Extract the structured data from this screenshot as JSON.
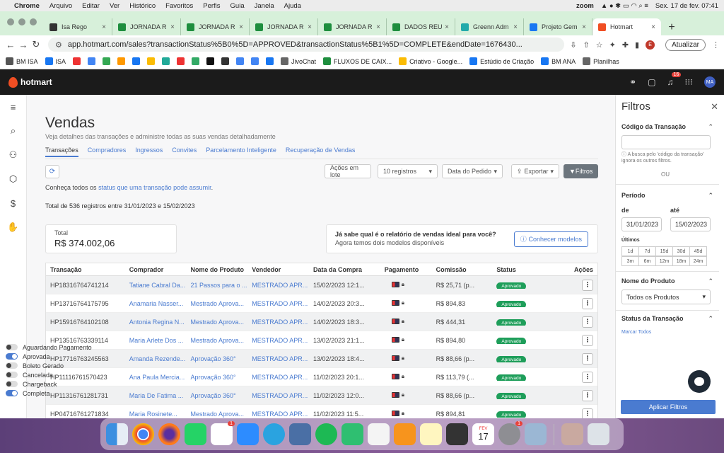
{
  "menubar": {
    "app": "Chrome",
    "items": [
      "Arquivo",
      "Editar",
      "Ver",
      "Histórico",
      "Favoritos",
      "Perfis",
      "Guia",
      "Janela",
      "Ajuda"
    ],
    "zoom": "zoom",
    "datetime": "Sex. 17 de fev.  07:41"
  },
  "browser": {
    "tabs": [
      {
        "label": "Isa Rego",
        "color": "#333"
      },
      {
        "label": "JORNADA R",
        "color": "#1e8e3e"
      },
      {
        "label": "JORNADA R",
        "color": "#1e8e3e"
      },
      {
        "label": "JORNADA R",
        "color": "#1e8e3e"
      },
      {
        "label": "JORNADA R",
        "color": "#1e8e3e"
      },
      {
        "label": "DADOS REU",
        "color": "#1e8e3e"
      },
      {
        "label": "Greenn Adm",
        "color": "#2aa"
      },
      {
        "label": "Projeto Gem",
        "color": "#1877f2"
      },
      {
        "label": "Hotmart",
        "color": "#f04e23"
      }
    ],
    "url": "app.hotmart.com/sales?transactionStatus%5B0%5D=APPROVED&transactionStatus%5B1%5D=COMPLETE&endDate=1676430...",
    "update_label": "Atualizar",
    "bookmarks": [
      {
        "label": "BM ISA",
        "color": "#555"
      },
      {
        "label": "ISA",
        "color": "#1877f2"
      },
      {
        "label": "",
        "color": "#e33"
      },
      {
        "label": "",
        "color": "#4285f4"
      },
      {
        "label": "",
        "color": "#34a853"
      },
      {
        "label": "",
        "color": "#f90"
      },
      {
        "label": "",
        "color": "#1877f2"
      },
      {
        "label": "",
        "color": "#fbbc04"
      },
      {
        "label": "",
        "color": "#2a9"
      },
      {
        "label": "",
        "color": "#e33"
      },
      {
        "label": "",
        "color": "#3a6"
      },
      {
        "label": "",
        "color": "#111"
      },
      {
        "label": "",
        "color": "#333"
      },
      {
        "label": "",
        "color": "#4285f4"
      },
      {
        "label": "",
        "color": "#4285f4"
      },
      {
        "label": "",
        "color": "#1877f2"
      },
      {
        "label": "JivoChat",
        "color": "#666"
      },
      {
        "label": "FLUXOS DE CAIX...",
        "color": "#1e8e3e"
      },
      {
        "label": "Criativo - Google...",
        "color": "#fbbc04"
      },
      {
        "label": "Estúdio de Criação",
        "color": "#1877f2"
      },
      {
        "label": "BM ANA",
        "color": "#1877f2"
      },
      {
        "label": "Planilhas",
        "color": "#666"
      }
    ]
  },
  "header": {
    "brand": "hotmart",
    "notifications": "16",
    "avatar": "MA"
  },
  "page": {
    "title": "Vendas",
    "subtitle": "Veja detalhes das transações e administre todas as suas vendas detalhadamente",
    "tabs": [
      "Transações",
      "Compradores",
      "Ingressos",
      "Convites",
      "Parcelamento Inteligente",
      "Recuperação de Vendas"
    ],
    "bulk_label": "Ações em lote",
    "per_page": "10 registros",
    "sort": "Data do Pedido",
    "export": "Exportar",
    "filters": "Filtros",
    "info_prefix": "Conheça todos os ",
    "info_link": "status que uma transação pode assumir",
    "info_suffix": ".",
    "total_text": "Total de 536 registros entre 31/01/2023 e 15/02/2023",
    "total_label": "Total",
    "total_value": "R$ 374.002,06",
    "promo_bold": "Já sabe qual é o relatório de vendas ideal para você?",
    "promo_rest": " Agora temos dois modelos disponíveis",
    "promo_button": "Conhecer modelos"
  },
  "table": {
    "headers": [
      "Transação",
      "Comprador",
      "Nome do Produto",
      "Vendedor",
      "Data da Compra",
      "Pagamento",
      "Comissão",
      "Status",
      "Ações"
    ],
    "rows": [
      {
        "id": "HP18316764741214",
        "buyer": "Tatiane Cabral Da...",
        "product": "21 Passos para o ...",
        "seller": "MESTRADO APR...",
        "date": "15/02/2023 12:1...",
        "commission": "R$ 25,71 (p...",
        "status": "Aprovado"
      },
      {
        "id": "HP13716764175795",
        "buyer": "Anamaria Nasser...",
        "product": "Mestrado Aprova...",
        "seller": "MESTRADO APR...",
        "date": "14/02/2023 20:3...",
        "commission": "R$ 894,83",
        "status": "Aprovado"
      },
      {
        "id": "HP15916764102108",
        "buyer": "Antonia Regina N...",
        "product": "Mestrado Aprova...",
        "seller": "MESTRADO APR...",
        "date": "14/02/2023 18:3...",
        "commission": "R$ 444,31",
        "status": "Aprovado"
      },
      {
        "id": "HP13516763339114",
        "buyer": "Maria Arlete Dos ...",
        "product": "Mestrado Aprova...",
        "seller": "MESTRADO APR...",
        "date": "13/02/2023 21:1...",
        "commission": "R$ 894,80",
        "status": "Aprovado"
      },
      {
        "id": "HP17716763245563",
        "buyer": "Amanda Rezende...",
        "product": "Aprovação 360°",
        "seller": "MESTRADO APR...",
        "date": "13/02/2023 18:4...",
        "commission": "R$ 88,66 (p...",
        "status": "Aprovado"
      },
      {
        "id": "HP11116761570423",
        "buyer": "Ana Paula Mercia...",
        "product": "Aprovação 360°",
        "seller": "MESTRADO APR...",
        "date": "11/02/2023 20:1...",
        "commission": "R$ 113,79 (...",
        "status": "Aprovado"
      },
      {
        "id": "HP11316761281731",
        "buyer": "Maria De Fatima ...",
        "product": "Aprovação 360°",
        "seller": "MESTRADO APR...",
        "date": "11/02/2023 12:0...",
        "commission": "R$ 88,66 (p...",
        "status": "Aprovado"
      },
      {
        "id": "HP04716761271834",
        "buyer": "Maria Rosinete...",
        "product": "Mestrado Aprova...",
        "seller": "MESTRADO APR...",
        "date": "11/02/2023 11:5...",
        "commission": "R$ 894,81",
        "status": "Aprovado"
      }
    ]
  },
  "filters_panel": {
    "title": "Filtros",
    "code_label": "Código da Transação",
    "code_hint": "A busca pelo 'código da transação' ignora os outros filtros.",
    "or": "OU",
    "period_label": "Período",
    "from_label": "de",
    "to_label": "até",
    "from_value": "31/01/2023",
    "to_value": "15/02/2023",
    "last_label": "Últimos",
    "chips_row1": [
      "1d",
      "7d",
      "15d",
      "30d",
      "45d"
    ],
    "chips_row2": [
      "3m",
      "6m",
      "12m",
      "18m",
      "24m"
    ],
    "product_label": "Nome do Produto",
    "product_value": "Todos os Produtos",
    "status_label": "Status da Transação",
    "mark_all": "Marcar Todos",
    "statuses": [
      {
        "label": "Aguardando Pagamento",
        "on": false
      },
      {
        "label": "Aprovada",
        "on": true
      },
      {
        "label": "Boleto Gerado",
        "on": false
      },
      {
        "label": "Cancelada",
        "on": false
      },
      {
        "label": "Chargeback",
        "on": false
      },
      {
        "label": "Completa",
        "on": true
      }
    ],
    "apply": "Aplicar Filtros"
  },
  "dock": {
    "calendar_month": "FEV",
    "calendar_day": "17",
    "badges": {
      "reminders": "1",
      "settings": "1"
    }
  }
}
